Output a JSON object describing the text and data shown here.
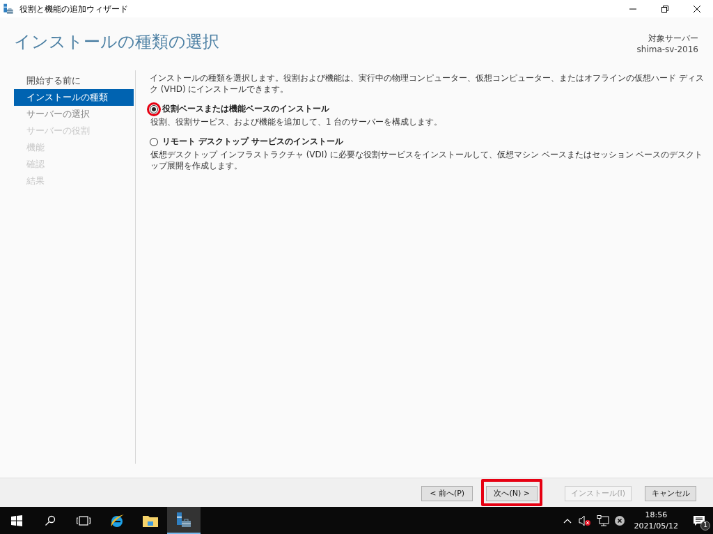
{
  "window": {
    "title": "役割と機能の追加ウィザード"
  },
  "header": {
    "title": "インストールの種類の選択",
    "target_label": "対象サーバー",
    "target_server": "shima-sv-2016"
  },
  "sidebar": {
    "items": [
      {
        "label": "開始する前に",
        "selected": false,
        "visited": true,
        "disabled": false
      },
      {
        "label": "インストールの種類",
        "selected": true,
        "visited": true,
        "disabled": false
      },
      {
        "label": "サーバーの選択",
        "selected": false,
        "visited": false,
        "disabled": false
      },
      {
        "label": "サーバーの役割",
        "selected": false,
        "visited": false,
        "disabled": true
      },
      {
        "label": "機能",
        "selected": false,
        "visited": false,
        "disabled": true
      },
      {
        "label": "確認",
        "selected": false,
        "visited": false,
        "disabled": true
      },
      {
        "label": "結果",
        "selected": false,
        "visited": false,
        "disabled": true
      }
    ]
  },
  "content": {
    "intro": "インストールの種類を選択します。役割および機能は、実行中の物理コンピューター、仮想コンピューター、またはオフラインの仮想ハード ディスク (VHD) にインストールできます。",
    "options": [
      {
        "label": "役割ベースまたは機能ベースのインストール",
        "description": "役割、役割サービス、および機能を追加して、1 台のサーバーを構成します。",
        "selected": true,
        "highlighted": true
      },
      {
        "label": "リモート デスクトップ サービスのインストール",
        "description": "仮想デスクトップ インフラストラクチャ (VDI) に必要な役割サービスをインストールして、仮想マシン ベースまたはセッション ベースのデスクトップ展開を作成します。",
        "selected": false,
        "highlighted": false
      }
    ]
  },
  "buttons": [
    {
      "label": "< 前へ(P)",
      "disabled": false,
      "highlighted": false
    },
    {
      "label": "次へ(N) >",
      "disabled": false,
      "highlighted": true
    },
    {
      "label": "インストール(I)",
      "disabled": true,
      "highlighted": false
    },
    {
      "label": "キャンセル",
      "disabled": false,
      "highlighted": false
    }
  ],
  "taskbar": {
    "time": "18:56",
    "date": "2021/05/12",
    "notification_count": "1"
  }
}
